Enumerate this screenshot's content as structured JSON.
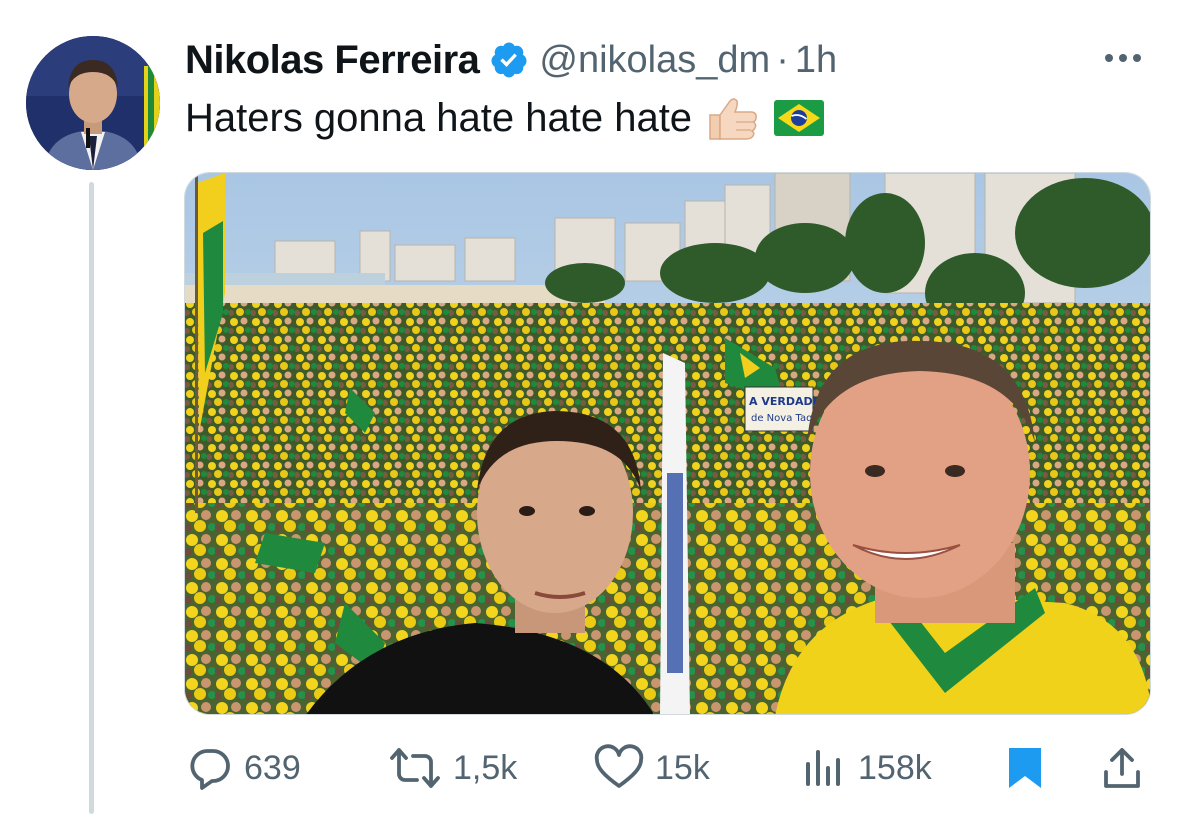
{
  "author": {
    "display_name": "Nikolas Ferreira",
    "handle": "@nikolas_dm",
    "separator": "·",
    "time": "1h",
    "verified": true
  },
  "tweet": {
    "text": "Haters gonna hate hate hate",
    "emojis": [
      "thumbs-up-icon",
      "brazil-flag-icon"
    ]
  },
  "media": {
    "sign_text": "A VERDADEIRA de Nova Taq"
  },
  "actions": {
    "reply_count": "639",
    "retweet_count": "1,5k",
    "like_count": "15k",
    "view_count": "158k"
  },
  "colors": {
    "text_primary": "#0f1419",
    "text_secondary": "#536471",
    "verified_blue": "#1d9bf0",
    "bookmark_blue": "#1d9bf0",
    "thread_line": "#cfd9de"
  }
}
